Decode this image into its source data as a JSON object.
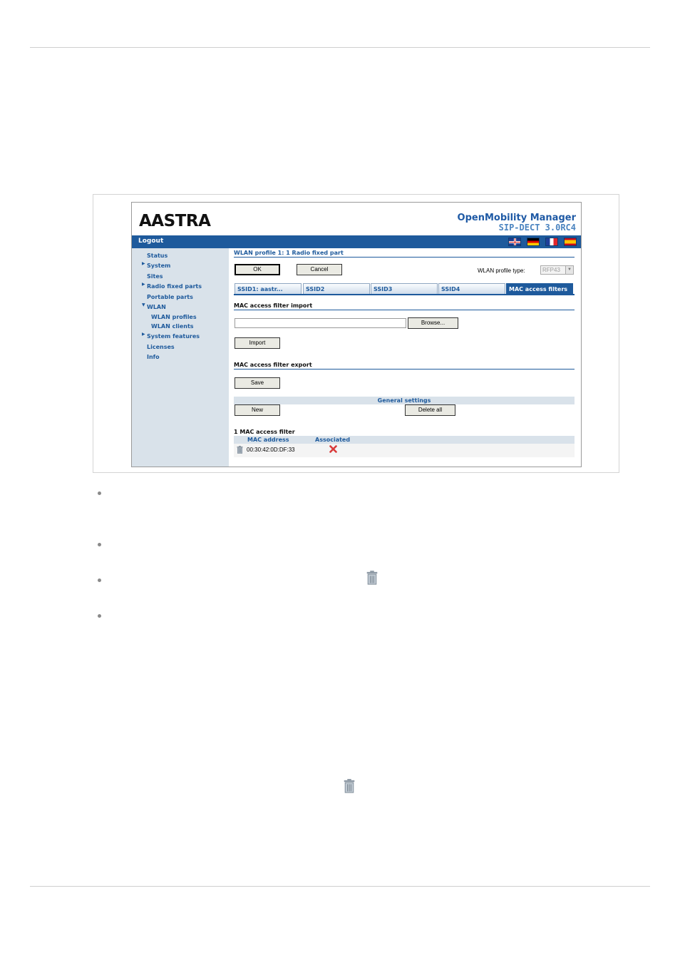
{
  "header": {
    "logo_text": "AASTRA",
    "product_name": "OpenMobility Manager",
    "product_version": "SIP-DECT 3.0RC4"
  },
  "topbar": {
    "logout_label": "Logout",
    "languages": [
      "English",
      "Deutsch",
      "Français",
      "Español"
    ]
  },
  "sidebar": {
    "items": [
      {
        "label": "Status",
        "expandable": false
      },
      {
        "label": "System",
        "expandable": true
      },
      {
        "label": "Sites",
        "expandable": false
      },
      {
        "label": "Radio fixed parts",
        "expandable": true
      },
      {
        "label": "Portable parts",
        "expandable": false
      },
      {
        "label": "WLAN",
        "expandable": true,
        "expanded": true
      },
      {
        "label": "WLAN profiles",
        "sub": true
      },
      {
        "label": "WLAN clients",
        "sub": true
      },
      {
        "label": "System features",
        "expandable": true
      },
      {
        "label": "Licenses",
        "expandable": false
      },
      {
        "label": "Info",
        "expandable": false
      }
    ]
  },
  "main": {
    "page_title": "WLAN profile 1: 1 Radio fixed part",
    "ok_label": "OK",
    "cancel_label": "Cancel",
    "profile_type_label": "WLAN profile type:",
    "profile_type_value": "RFP43",
    "tabs": [
      {
        "label": "SSID1: aastr...",
        "active": false
      },
      {
        "label": "SSID2",
        "active": false
      },
      {
        "label": "SSID3",
        "active": false
      },
      {
        "label": "SSID4",
        "active": false
      },
      {
        "label": "MAC access filters",
        "active": true
      }
    ],
    "import": {
      "title": "MAC access filter import",
      "file_value": "",
      "browse_label": "Browse...",
      "import_label": "Import"
    },
    "export": {
      "title": "MAC access filter export",
      "save_label": "Save"
    },
    "general": {
      "title": "General settings",
      "new_label": "New",
      "delete_all_label": "Delete all"
    },
    "list": {
      "count_title": "1 MAC access filter",
      "columns": [
        "MAC address",
        "Associated"
      ],
      "rows": [
        {
          "mac": "00:30:42:0D:DF:33",
          "associated": false
        }
      ]
    }
  },
  "colors": {
    "brand_blue": "#1e5a9c",
    "sidebar_bg": "#d9e2ea",
    "delete_red": "#d93a3a"
  }
}
